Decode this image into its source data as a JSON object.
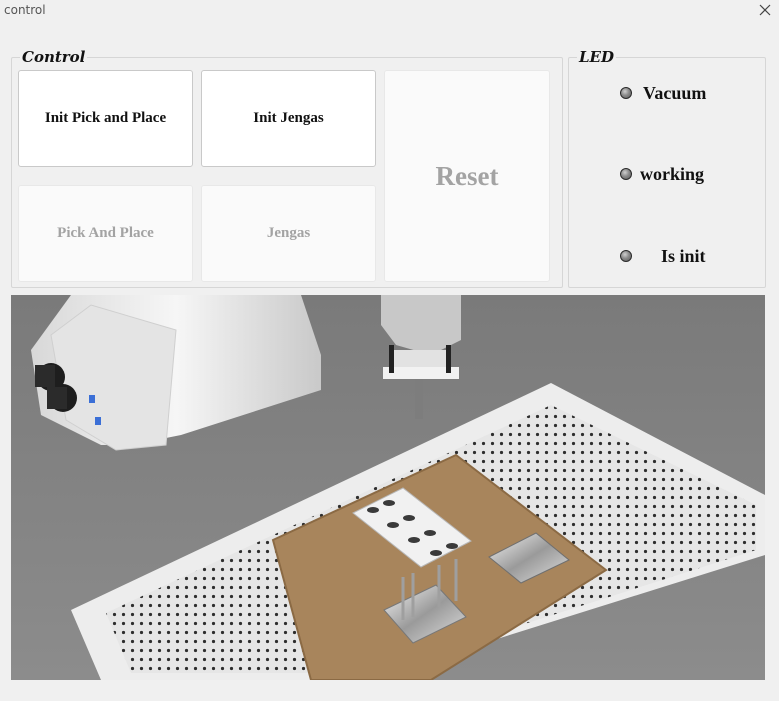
{
  "window": {
    "title": "control"
  },
  "control_group": {
    "title": "Control",
    "buttons": {
      "init_pick_and_place": "Init Pick and Place",
      "init_jengas": "Init Jengas",
      "pick_and_place": "Pick And Place",
      "jengas": "Jengas",
      "reset": "Reset"
    }
  },
  "led_group": {
    "title": "LED",
    "leds": [
      {
        "label": "Vacuum",
        "state": "off"
      },
      {
        "label": "working",
        "state": "off"
      },
      {
        "label": "Is init",
        "state": "off"
      }
    ]
  },
  "colors": {
    "window_bg": "#f0f0f0",
    "button_bg": "#ffffff",
    "disabled_text": "#a3a3a3",
    "led_off": "#8a8a8a"
  }
}
